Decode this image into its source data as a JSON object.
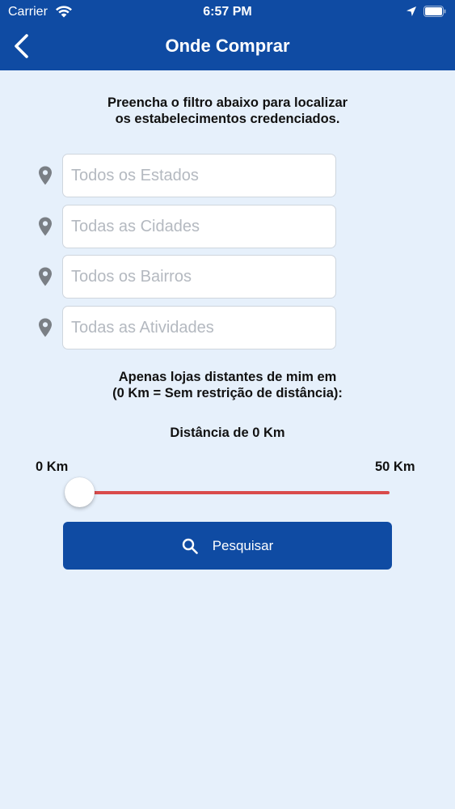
{
  "status_bar": {
    "carrier": "Carrier",
    "time": "6:57 PM",
    "icons": [
      "wifi-icon",
      "location-arrow-icon",
      "battery-icon"
    ]
  },
  "nav": {
    "title": "Onde Comprar",
    "back_icon": "chevron-left-icon"
  },
  "intro": {
    "line1": "Preencha o filtro abaixo para localizar",
    "line2": "os estabelecimentos credenciados."
  },
  "filters": [
    {
      "icon": "map-pin-icon",
      "value": "",
      "placeholder": "Todos os Estados"
    },
    {
      "icon": "map-pin-icon",
      "value": "",
      "placeholder": "Todas as Cidades"
    },
    {
      "icon": "map-pin-icon",
      "value": "",
      "placeholder": "Todos os Bairros"
    },
    {
      "icon": "map-pin-icon",
      "value": "",
      "placeholder": "Todas as Atividades"
    }
  ],
  "distance": {
    "line1": "Apenas lojas distantes de mim em",
    "line2": "(0 Km = Sem restrição de distância):",
    "current_label": "Distância de 0 Km",
    "min_label": "0 Km",
    "max_label": "50 Km",
    "min": 0,
    "max": 50,
    "value": 0
  },
  "search_button": {
    "label": "Pesquisar",
    "icon": "search-icon"
  },
  "colors": {
    "primary": "#0f4ba3",
    "background": "#e6f0fb",
    "slider_track": "#d94b4b",
    "pin": "#7a7f85"
  }
}
